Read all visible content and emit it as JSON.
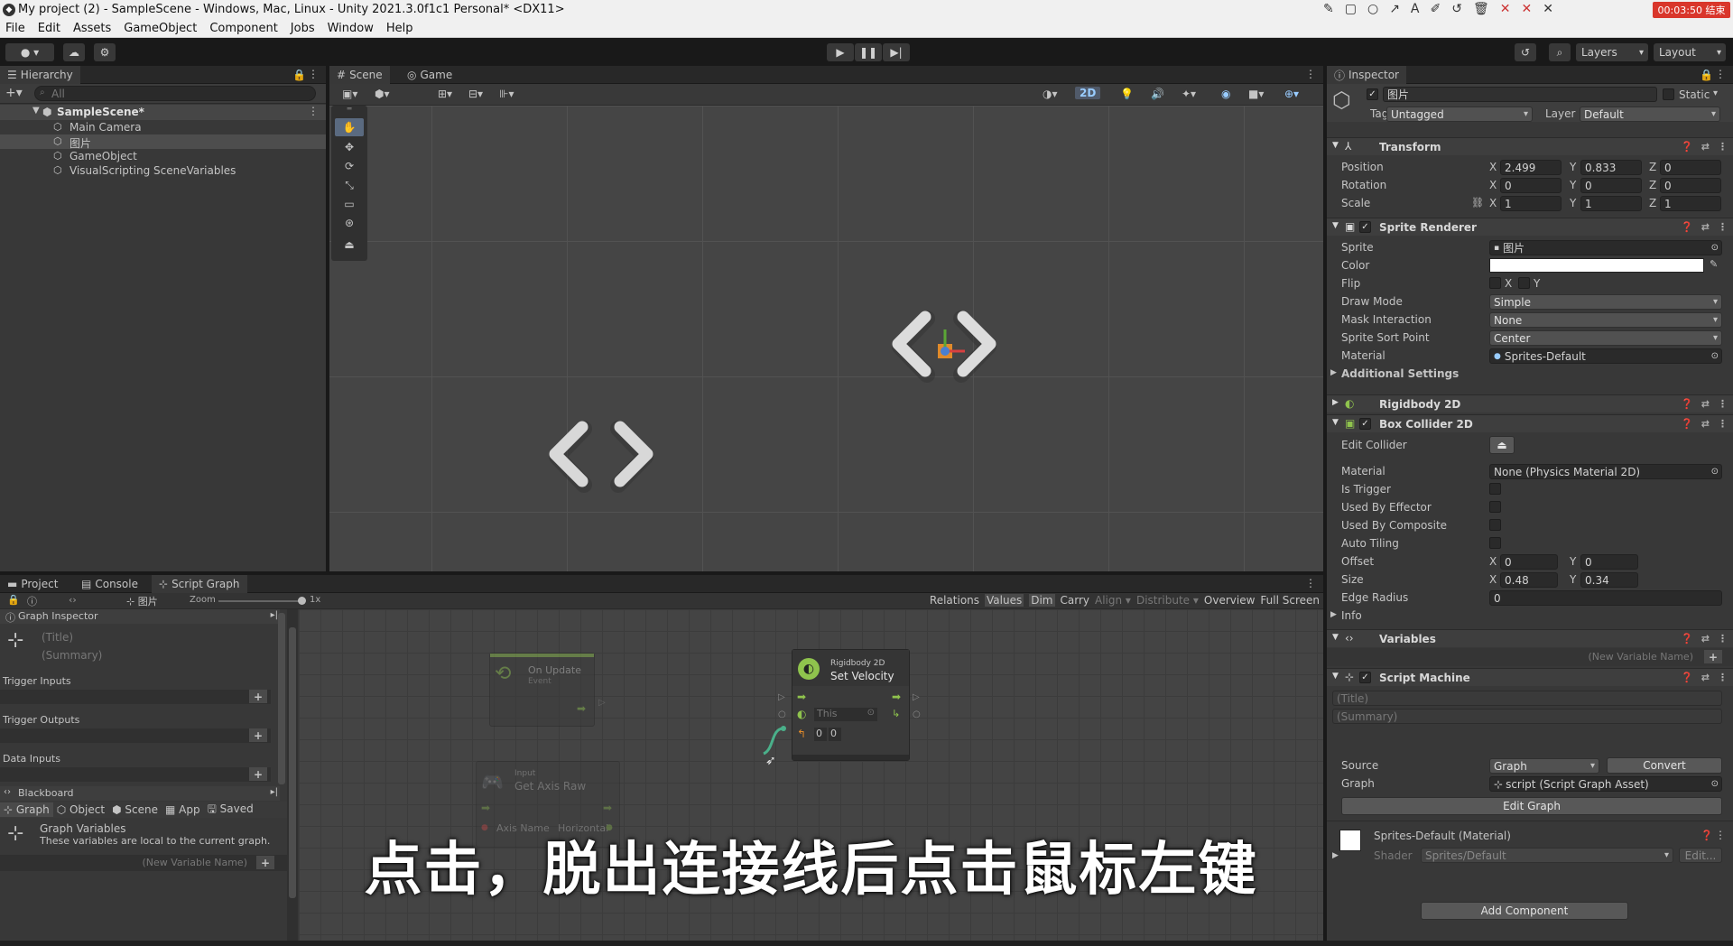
{
  "window": {
    "title": "My project (2) - SampleScene - Windows, Mac, Linux - Unity 2021.3.0f1c1 Personal* <DX11>",
    "rec_timer": "00:03:50 结束"
  },
  "menu": [
    "File",
    "Edit",
    "Assets",
    "GameObject",
    "Component",
    "Jobs",
    "Window",
    "Help"
  ],
  "toolbar": {
    "layers": "Layers",
    "layout": "Layout"
  },
  "hierarchy": {
    "tab": "Hierarchy",
    "search_placeholder": "All",
    "scene": "SampleScene*",
    "items": [
      "Main Camera",
      "图片",
      "GameObject",
      "VisualScripting SceneVariables"
    ]
  },
  "scene_view": {
    "tab_scene": "Scene",
    "tab_game": "Game",
    "mode_2d": "2D"
  },
  "bottom": {
    "tabs": [
      "Project",
      "Console",
      "Script Graph"
    ],
    "breadcrumb": "图片",
    "zoom_label": "Zoom",
    "zoom_value": "1x",
    "graph_menu": [
      "Relations",
      "Values",
      "Dim",
      "Carry",
      "Align",
      "Distribute",
      "Overview",
      "Full Screen"
    ],
    "graph_inspector": "Graph Inspector",
    "title_placeholder": "(Title)",
    "summary_placeholder": "(Summary)",
    "trigger_inputs": "Trigger Inputs",
    "trigger_outputs": "Trigger Outputs",
    "data_inputs": "Data Inputs",
    "blackboard": "Blackboard",
    "bb_tabs": [
      "Graph",
      "Object",
      "Scene",
      "App",
      "Saved"
    ],
    "graph_variables_title": "Graph Variables",
    "graph_variables_desc": "These variables are local to the current graph.",
    "new_variable_name": "(New Variable Name)",
    "nodes": {
      "on_update_title": "On Update",
      "on_update_sub": "Event",
      "set_velocity_top": "Rigidbody 2D",
      "set_velocity_title": "Set Velocity",
      "this_label": "This",
      "vec_x": "0",
      "vec_y": "0",
      "input_top": "Input",
      "input_title": "Get Axis Raw",
      "axis_name_label": "Axis Name",
      "axis_name_value": "Horizontal"
    },
    "subtitle": "点击，脱出连接线后点击鼠标左键"
  },
  "inspector": {
    "tab": "Inspector",
    "object_name": "图片",
    "static_label": "Static",
    "tag_label": "Tag",
    "tag_value": "Untagged",
    "layer_label": "Layer",
    "layer_value": "Default",
    "transform": {
      "title": "Transform",
      "position": {
        "label": "Position",
        "x": "2.499",
        "y": "0.833",
        "z": "0"
      },
      "rotation": {
        "label": "Rotation",
        "x": "0",
        "y": "0",
        "z": "0"
      },
      "scale": {
        "label": "Scale",
        "x": "1",
        "y": "1",
        "z": "1"
      }
    },
    "sprite_renderer": {
      "title": "Sprite Renderer",
      "sprite_label": "Sprite",
      "sprite_value": "图片",
      "color_label": "Color",
      "color_value": "#ffffff",
      "flip_label": "Flip",
      "flip_x": "X",
      "flip_y": "Y",
      "draw_mode_label": "Draw Mode",
      "draw_mode_value": "Simple",
      "mask_label": "Mask Interaction",
      "mask_value": "None",
      "sort_point_label": "Sprite Sort Point",
      "sort_point_value": "Center",
      "material_label": "Material",
      "material_value": "Sprites-Default",
      "additional": "Additional Settings"
    },
    "rigidbody": {
      "title": "Rigidbody 2D"
    },
    "box_collider": {
      "title": "Box Collider 2D",
      "edit_collider": "Edit Collider",
      "material_label": "Material",
      "material_value": "None (Physics Material 2D)",
      "is_trigger": "Is Trigger",
      "used_by_effector": "Used By Effector",
      "used_by_composite": "Used By Composite",
      "auto_tiling": "Auto Tiling",
      "offset_label": "Offset",
      "offset_x": "0",
      "offset_y": "0",
      "size_label": "Size",
      "size_x": "0.48",
      "size_y": "0.34",
      "edge_radius_label": "Edge Radius",
      "edge_radius_value": "0",
      "info": "Info"
    },
    "variables": {
      "title": "Variables",
      "new_variable": "(New Variable Name)"
    },
    "script_machine": {
      "title": "Script Machine",
      "title_placeholder": "(Title)",
      "summary_placeholder": "(Summary)",
      "source_label": "Source",
      "source_value": "Graph",
      "convert": "Convert",
      "graph_label": "Graph",
      "graph_value": "script (Script Graph Asset)",
      "edit_graph": "Edit Graph"
    },
    "material_asset": {
      "title": "Sprites-Default (Material)",
      "shader_label": "Shader",
      "shader_value": "Sprites/Default",
      "edit": "Edit..."
    },
    "add_component": "Add Component"
  },
  "colors": {
    "accent_green": "#8fc34d",
    "rec_red": "#d9362b",
    "selection": "#4d4d4d"
  }
}
